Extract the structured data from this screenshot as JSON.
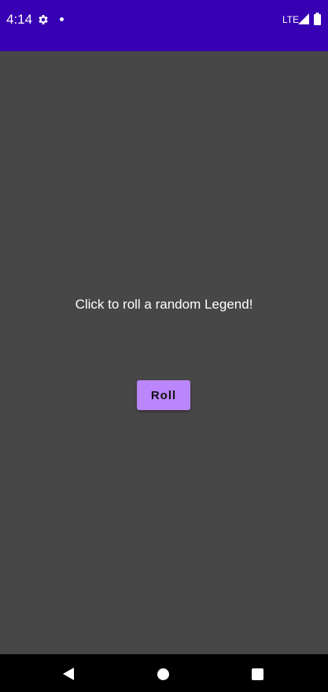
{
  "status_bar": {
    "time": "4:14",
    "network": "LTE",
    "background": "#3700b3",
    "icons": [
      "gear-icon",
      "notification-dot-icon",
      "signal-icon",
      "battery-icon"
    ]
  },
  "main": {
    "background": "#474747",
    "prompt": "Click to roll a random Legend!",
    "roll_button": {
      "label": "Roll",
      "color": "#bb86fc"
    }
  },
  "nav_bar": {
    "background": "#000000",
    "icons": [
      "back-icon",
      "home-icon",
      "recents-icon"
    ]
  }
}
